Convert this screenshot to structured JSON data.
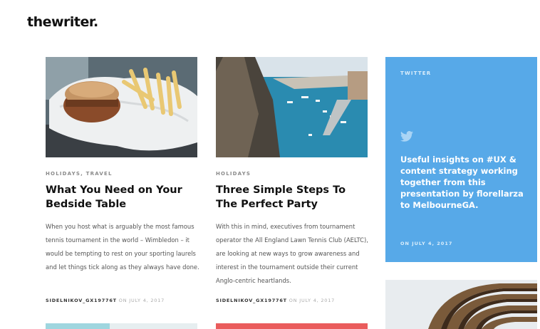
{
  "site": {
    "logo": "thewriter."
  },
  "posts": [
    {
      "category": "HOLIDAYS, TRAVEL",
      "title": "What You Need on Your Bedside Table",
      "excerpt": "When you host what is arguably the most famous tennis tournament in the world – Wimbledon – it would be tempting to rest on your sporting laurels and let things tick along as they always have done.",
      "author": "SIDELNIKOV_GX19776T",
      "date": "ON JULY 4, 2017"
    },
    {
      "category": "HOLIDAYS",
      "title": "Three Simple Steps To The Perfect Party",
      "excerpt": "With this in mind, executives from tournament operator the All England Lawn Tennis Club (AELTC), are looking at new ways to grow awareness and interest in the tournament outside their current Anglo-centric heartlands.",
      "author": "SIDELNIKOV_GX19776T",
      "date": "ON JULY 4, 2017"
    }
  ],
  "twitter": {
    "label": "TWITTER",
    "text": "Useful insights on #UX & content strategy working together from this presentation by florellarza to MelbourneGA.",
    "date": "ON JULY 4, 2017",
    "icon": "twitter-bird-icon",
    "bg_color": "#57a9e8"
  }
}
